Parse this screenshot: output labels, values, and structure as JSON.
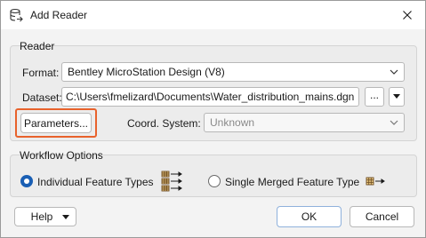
{
  "window": {
    "title": "Add Reader"
  },
  "reader": {
    "group_label": "Reader",
    "format_label": "Format:",
    "format_value": "Bentley MicroStation Design (V8)",
    "dataset_label": "Dataset:",
    "dataset_value": "C:\\Users\\fmelizard\\Documents\\Water_distribution_mains.dgn",
    "browse_label": "...",
    "parameters_label": "Parameters...",
    "coord_label": "Coord. System:",
    "coord_value": "Unknown"
  },
  "workflow": {
    "group_label": "Workflow Options",
    "option_individual": "Individual Feature Types",
    "option_merged": "Single Merged Feature Type",
    "selected": "individual"
  },
  "footer": {
    "help_label": "Help",
    "ok_label": "OK",
    "cancel_label": "Cancel"
  },
  "colors": {
    "highlight": "#e8622c",
    "radio_selected": "#1a5fb4"
  }
}
